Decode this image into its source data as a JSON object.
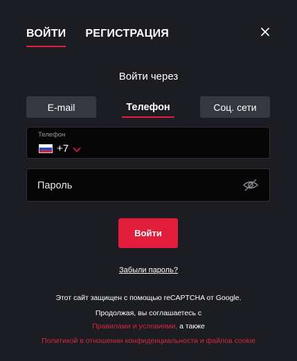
{
  "header": {
    "tabs": [
      {
        "label": "ВОЙТИ",
        "active": true
      },
      {
        "label": "РЕГИСТРАЦИЯ",
        "active": false
      }
    ],
    "close_icon": "close-icon"
  },
  "login_via": "Войти через",
  "methods": {
    "email": "E-mail",
    "phone": "Телефон",
    "social": "Соц. сети",
    "selected": "Телефон"
  },
  "phone_field": {
    "label": "Телефон",
    "country_flag": "russia-flag-icon",
    "country_code": "+7",
    "value": ""
  },
  "password_field": {
    "placeholder": "Пароль",
    "toggle_icon": "eye-slash-icon"
  },
  "submit_label": "Войти",
  "forgot_password": "Забыли пароль?",
  "legal": {
    "recaptcha": "Этот сайт защищен с помощью reCAPTCHA от Google.",
    "agree": "Продолжая, вы соглашаетесь с",
    "terms_link": "Правилами и условиями,",
    "and_also": " а также",
    "privacy_link": "Политикой в отношении конфиденциальности и файлов cookie"
  },
  "colors": {
    "background": "#1b1d22",
    "accent": "#e31e3c",
    "inactive_button": "#35383e",
    "field_background": "#060607"
  }
}
